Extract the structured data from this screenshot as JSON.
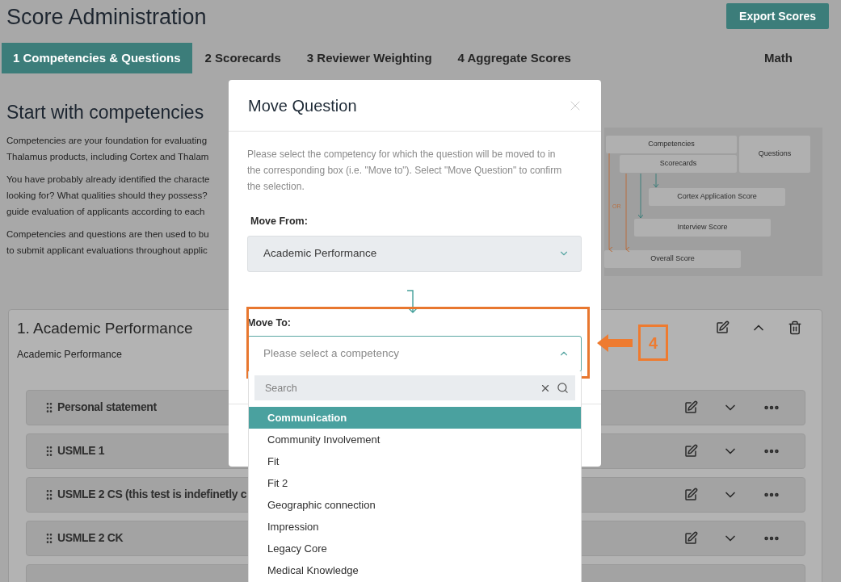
{
  "page": {
    "title": "Score Administration",
    "export_button": "Export Scores"
  },
  "tabs": [
    {
      "label": "1 Competencies & Questions",
      "selected": true
    },
    {
      "label": "2 Scorecards",
      "selected": false
    },
    {
      "label": "3 Reviewer Weighting",
      "selected": false
    },
    {
      "label": "4 Aggregate Scores",
      "selected": false
    }
  ],
  "tab_right": "Math",
  "intro": {
    "heading": "Start with competencies",
    "paragraphs": [
      [
        "Competencies are your foundation for evaluating",
        "Thalamus products, including Cortex and Thalam"
      ],
      [
        "You have probably already identified the characte",
        "looking for? What qualities should they possess?",
        "guide evaluation of applicants according to each"
      ],
      [
        "Competencies and questions are then used to bu",
        "to submit applicant evaluations throughout applic"
      ]
    ]
  },
  "diagram": {
    "nodes": [
      "Competencies",
      "Scorecards",
      "Questions",
      "Cortex Application Score",
      "Interview Score",
      "Overall Score"
    ],
    "or_label": "OR"
  },
  "competency": {
    "title": "1. Academic Performance",
    "subtitle": "Academic Performance",
    "expanded": true,
    "questions": [
      {
        "label": "Personal statement"
      },
      {
        "label": "USMLE 1"
      },
      {
        "label": "USMLE 2 CS (this test is indefinetly c"
      },
      {
        "label": "USMLE 2 CK"
      }
    ]
  },
  "modal": {
    "title": "Move Question",
    "description": "Please select the competency for which the question will be moved to in the corresponding box (i.e. \"Move to\"). Select \"Move Question\" to confirm the selection.",
    "move_from": {
      "label": "Move From:",
      "value": "Academic Performance"
    },
    "move_to": {
      "label": "Move To:",
      "placeholder": "Please select a competency",
      "expanded": true
    },
    "search": {
      "placeholder": "Search"
    },
    "options": [
      {
        "label": "Communication",
        "selected": true
      },
      {
        "label": "Community Involvement",
        "selected": false
      },
      {
        "label": "Fit",
        "selected": false
      },
      {
        "label": "Fit 2",
        "selected": false
      },
      {
        "label": "Geographic connection",
        "selected": false
      },
      {
        "label": "Impression",
        "selected": false
      },
      {
        "label": "Legacy Core",
        "selected": false
      },
      {
        "label": "Medical Knowledge",
        "selected": false
      }
    ]
  },
  "annotation": {
    "step": "4"
  }
}
